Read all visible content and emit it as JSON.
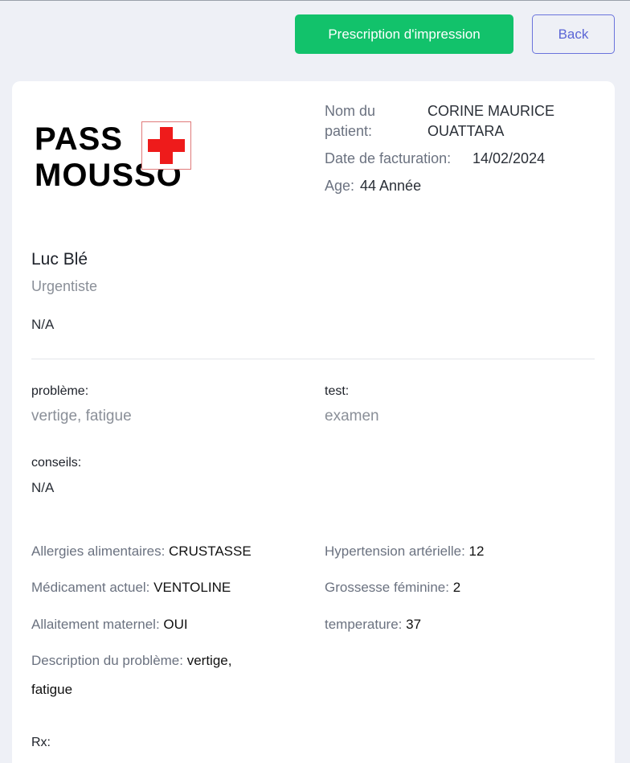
{
  "toolbar": {
    "print_label": "Prescription d'impression",
    "back_label": "Back"
  },
  "logo": {
    "line1": "PASS",
    "line2": "MOUSSO"
  },
  "patient": {
    "name_label_1": "Nom du",
    "name_label_2": "patient:",
    "name_value_1": "CORINE MAURICE",
    "name_value_2": "OUATTARA",
    "billing_label": "Date de facturation:",
    "billing_value": "14/02/2024",
    "age_label": "Age:",
    "age_value": "44 Année"
  },
  "doctor": {
    "name": "Luc Blé",
    "role": "Urgentiste",
    "extra": "N/A"
  },
  "consultation": {
    "problem_label": "problème:",
    "problem_value": "vertige, fatigue",
    "test_label": "test:",
    "test_value": "examen",
    "advice_label": "conseils:",
    "advice_value": "N/A"
  },
  "fields": {
    "allergies_label": "Allergies alimentaires:",
    "allergies_value": "CRUSTASSE",
    "hypertension_label": "Hypertension artérielle:",
    "hypertension_value": "12",
    "medication_label": "Médicament actuel:",
    "medication_value": "VENTOLINE",
    "pregnancy_label": "Grossesse féminine:",
    "pregnancy_value": "2",
    "breastfeeding_label": "Allaitement maternel:",
    "breastfeeding_value": "OUI",
    "temperature_label": "temperature:",
    "temperature_value": "37",
    "description_label": "Description du problème:",
    "description_value_1": "vertige,",
    "description_value_2": "fatigue"
  },
  "rx_label": "Rx:",
  "colors": {
    "print_button": "#12c26b",
    "back_button": "#5b65d6",
    "logo_cross": "#ee1b1b",
    "page_background": "#eef0f6"
  }
}
